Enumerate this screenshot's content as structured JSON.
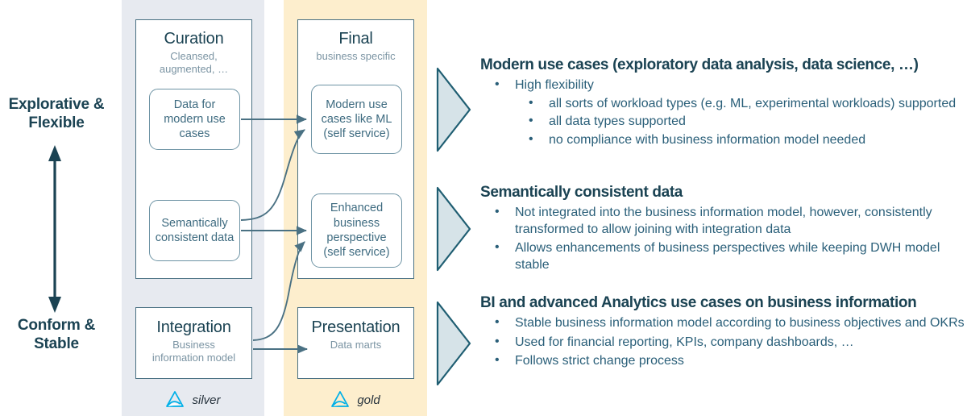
{
  "axis": {
    "top_label": "Explorative &\nFlexible",
    "top_label_line1": "Explorative &",
    "top_label_line2": "Flexible",
    "bottom_label_line1": "Conform &",
    "bottom_label_line2": "Stable",
    "arrow_color": "#1b4353"
  },
  "zones": [
    {
      "id": "silver",
      "footer_label": "silver",
      "background": "#e7eaf0",
      "logo": "delta-lake-logo"
    },
    {
      "id": "gold",
      "footer_label": "gold",
      "background": "#fdeecd",
      "logo": "delta-lake-logo"
    }
  ],
  "stages": {
    "curation": {
      "title": "Curation",
      "subtitle_line1": "Cleansed,",
      "subtitle_line2": "augmented, …",
      "sub_boxes": [
        {
          "id": "data-for-modern-use-cases",
          "text": "Data for modern use cases"
        },
        {
          "id": "semantically-consistent-data",
          "text": "Semantically consistent data"
        }
      ]
    },
    "final": {
      "title": "Final",
      "subtitle_line1": "business specific",
      "sub_boxes": [
        {
          "id": "modern-use-cases-like-ml",
          "text": "Modern use cases like ML (self service)"
        },
        {
          "id": "enhanced-business-perspective",
          "text": "Enhanced business perspective (self service)"
        }
      ]
    },
    "integration": {
      "title": "Integration",
      "subtitle_line1": "Business",
      "subtitle_line2": "information model"
    },
    "presentation": {
      "title": "Presentation",
      "subtitle_line1": "Data marts"
    }
  },
  "sections": [
    {
      "heading": "Modern use cases (exploratory data analysis, data science, …)",
      "bullets": [
        {
          "text": "High flexibility",
          "children": [
            {
              "text": "all sorts of workload types (e.g. ML, experimental workloads) supported"
            },
            {
              "text": "all data types supported"
            },
            {
              "text": "no compliance with business information model needed"
            }
          ]
        }
      ]
    },
    {
      "heading": "Semantically consistent data",
      "bullets": [
        {
          "text": "Not integrated into the business information model, however, consistently transformed to allow joining with integration data"
        },
        {
          "text": "Allows enhancements of business perspectives while keeping DWH model stable"
        }
      ]
    },
    {
      "heading": "BI and advanced Analytics use cases on business information",
      "bullets": [
        {
          "text": "Stable business information model according to business objectives and OKRs"
        },
        {
          "text": "Used for financial reporting, KPIs, company dashboards, …"
        },
        {
          "text": "Follows strict change process"
        }
      ]
    }
  ],
  "colors": {
    "heading": "#1b4353",
    "body_text": "#2a5f79",
    "box_border": "#4a7183",
    "sub_box_border": "#6d93a4",
    "sub_box_text": "#3e6b80",
    "subtitle": "#7b94a3",
    "connector": "#4a7183",
    "chevron_fill": "#d6e3e8",
    "chevron_stroke": "#1f5e72",
    "silver_bg": "#e7eaf0",
    "gold_bg": "#fdeecd",
    "logo": "#00b0e8"
  }
}
